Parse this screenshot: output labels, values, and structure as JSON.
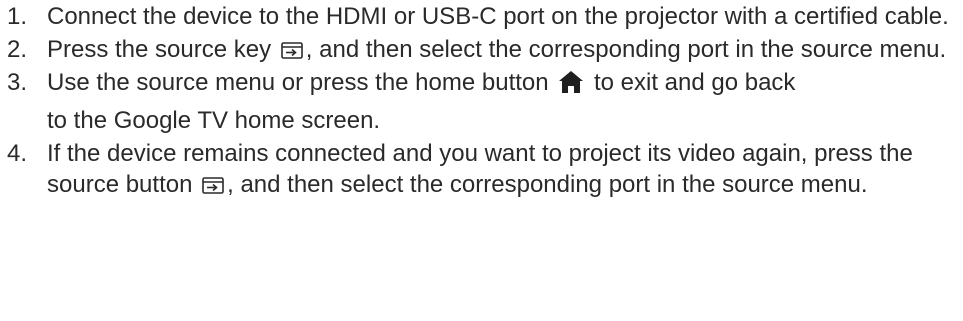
{
  "steps": [
    {
      "number": "1.",
      "text": "Connect the device to the HDMI or USB-C port on the projector with a certified cable."
    },
    {
      "number": "2.",
      "before": "Press the source key",
      "icon": "source-icon",
      "after": ", and then select the corresponding port in the source menu."
    },
    {
      "number": "3.",
      "before": "Use the source menu or press the home button",
      "icon": "home-icon",
      "after": "to exit and go back",
      "line2": "to the Google TV home screen."
    },
    {
      "number": "4.",
      "before": "If the device remains connected and you want to project its video again, press the source button",
      "icon": "source-icon",
      "after": ", and then select the corresponding port in the source menu."
    }
  ]
}
